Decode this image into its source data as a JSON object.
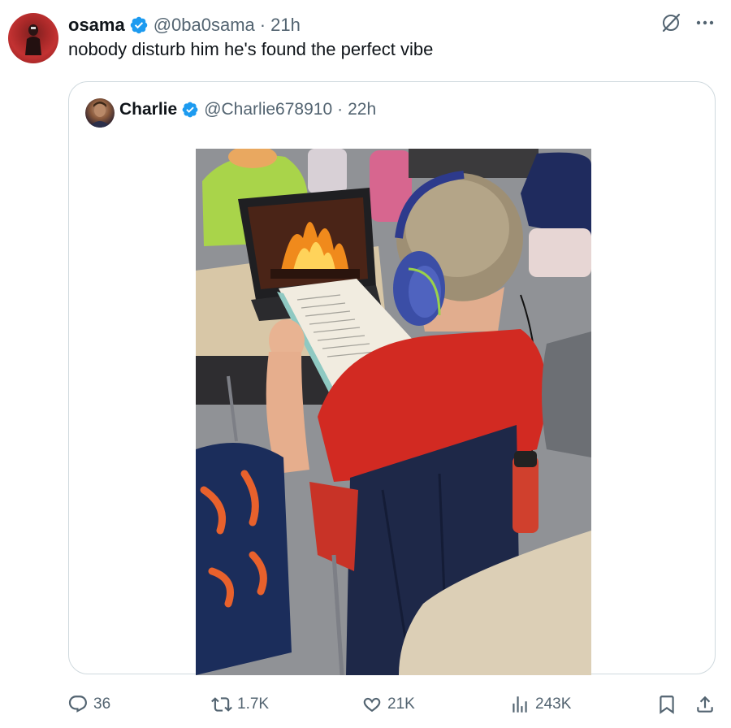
{
  "tweet": {
    "author_name": "osama",
    "handle": "@0ba0sama",
    "separator": "·",
    "time": "21h",
    "text": "nobody disturb him he's found the perfect vibe"
  },
  "quoted": {
    "author_name": "Charlie",
    "handle": "@Charlie678910",
    "separator": "·",
    "time": "22h"
  },
  "stats": {
    "replies": "36",
    "retweets": "1.7K",
    "likes": "21K",
    "views": "243K"
  },
  "icons": {
    "verified": "verified-badge-icon",
    "grok": "grok-icon",
    "more": "more-icon",
    "reply": "reply-icon",
    "retweet": "retweet-icon",
    "like": "heart-icon",
    "views": "views-icon",
    "bookmark": "bookmark-icon",
    "share": "share-icon"
  },
  "colors": {
    "verified": "#1d9bf0",
    "secondary_text": "#536471",
    "border": "#cfd9de"
  }
}
